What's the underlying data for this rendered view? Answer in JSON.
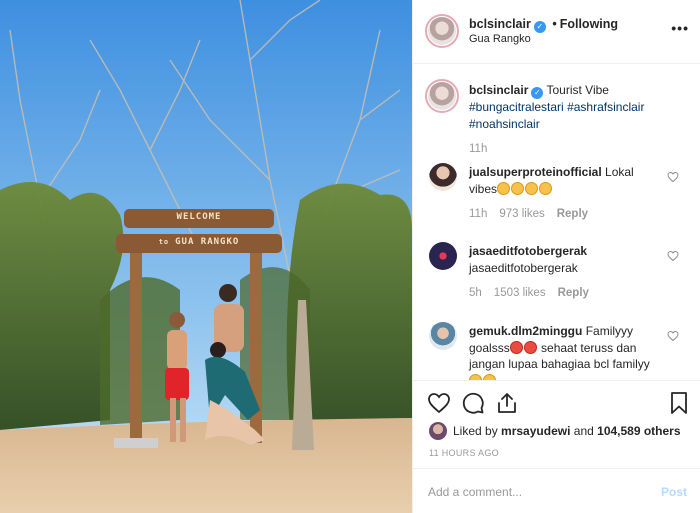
{
  "post": {
    "username": "bclsinclair",
    "separator": "•",
    "follow_status": "Following",
    "location": "Gua Rangko",
    "more_label": "•••",
    "verified_mark": "✓"
  },
  "photo": {
    "sign_top": "WELCOME",
    "sign_bottom_prefix": "to",
    "sign_bottom": "GUA RANGKO"
  },
  "caption": {
    "username": "bclsinclair",
    "text": "Tourist Vibe",
    "hashtags": [
      "#bungacitralestari",
      "#ashrafsinclair",
      "#noahsinclair"
    ],
    "time": "11h"
  },
  "comments": [
    {
      "username": "jualsuperproteinofficial",
      "text": "Lokal vibes",
      "emoji": [
        "grin",
        "grin",
        "grin",
        "grin"
      ],
      "time": "11h",
      "likes": "973 likes",
      "reply": "Reply"
    },
    {
      "username": "jasaeditfotobergerak",
      "text": "jasaeditfotobergerak",
      "emoji": [],
      "time": "5h",
      "likes": "1503 likes",
      "reply": "Reply"
    },
    {
      "username": "gemuk.dlm2minggu",
      "text_a": "Familyyy goalsss",
      "text_b": "sehaat teruss dan jangan lupaa bahagiaa bcl familyy",
      "emoji": [
        "heart-eyes",
        "heart-eyes",
        "grin",
        "grin",
        "heart"
      ]
    }
  ],
  "actions": {
    "liked_by_prefix": "Liked by",
    "liked_by_user": "mrsayudewi",
    "liked_by_and": "and",
    "liked_by_count": "104,589 others",
    "timestamp": "11 HOURS AGO"
  },
  "add_comment": {
    "placeholder": "Add a comment...",
    "post_label": "Post"
  },
  "colors": {
    "link": "#003569",
    "verified": "#3897f0",
    "muted": "#999999",
    "post_disabled": "#b3dbff"
  }
}
